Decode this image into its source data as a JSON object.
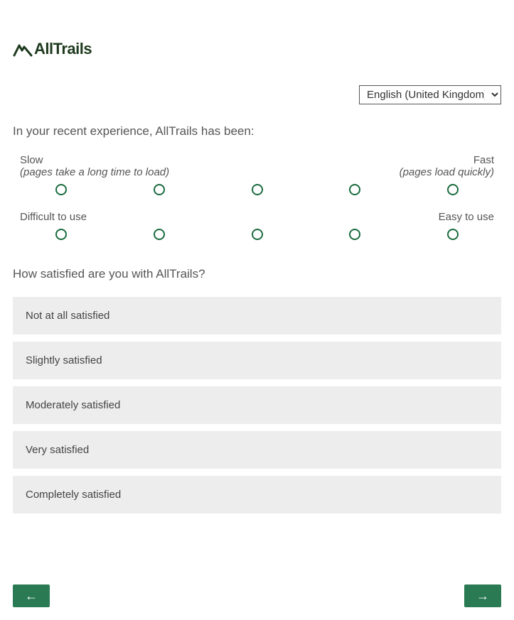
{
  "brand": "AllTrails",
  "language": {
    "selected": "English (United Kingdom)"
  },
  "question1": {
    "prompt": "In your recent experience, AllTrails has been:",
    "scales": [
      {
        "left_label": "Slow",
        "left_sub": "(pages take a long time to load)",
        "right_label": "Fast",
        "right_sub": "(pages load quickly)"
      },
      {
        "left_label": "Difficult to use",
        "left_sub": "",
        "right_label": "Easy to use",
        "right_sub": ""
      }
    ]
  },
  "question2": {
    "prompt": "How satisfied are you with AllTrails?",
    "options": [
      "Not at all satisfied",
      "Slightly satisfied",
      "Moderately satisfied",
      "Very satisfied",
      "Completely satisfied"
    ]
  },
  "nav": {
    "prev": "←",
    "next": "→"
  }
}
